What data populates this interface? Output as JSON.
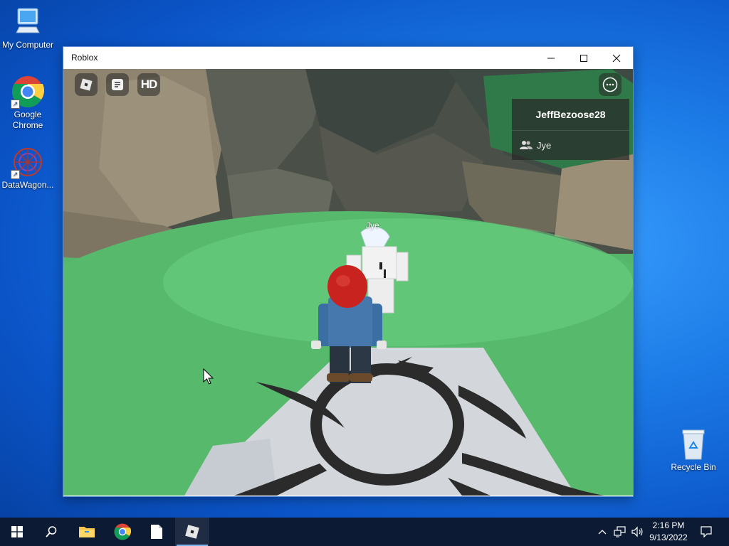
{
  "desktop": {
    "icons": [
      {
        "label": "My Computer"
      },
      {
        "label": "Google\nChrome"
      },
      {
        "label": "DataWagon..."
      },
      {
        "label": "Recycle Bin"
      }
    ]
  },
  "window": {
    "title": "Roblox",
    "controls": [
      "minimize",
      "maximize",
      "close"
    ]
  },
  "game": {
    "hud": {
      "roblox_menu_icon": "roblox-logo-icon",
      "chat_icon": "chat-icon",
      "hd_label": "HD",
      "more_icon": "more-options-icon"
    },
    "player_list": {
      "local_player": "JeffBezoose28",
      "others": [
        "Jye"
      ]
    },
    "nametag": "Jye"
  },
  "taskbar": {
    "items": [
      "start-icon",
      "search-icon",
      "file-explorer-icon",
      "chrome-icon",
      "notepad-icon",
      "roblox-icon"
    ],
    "active_item": "roblox-icon",
    "clock_time": "2:16 PM",
    "clock_date": "9/13/2022"
  },
  "colors": {
    "accent": "#0078d7",
    "taskbar": "#0c1b33",
    "grass": "#55b66b"
  }
}
